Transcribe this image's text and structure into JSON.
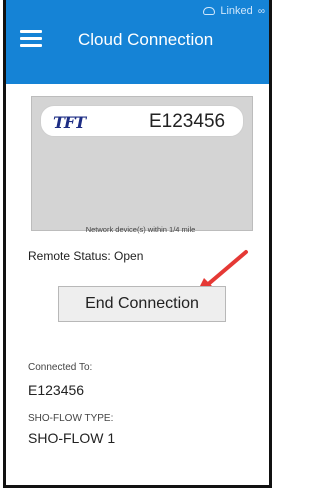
{
  "status_bar": {
    "linked_text": "Linked",
    "link_icon": "link-icon",
    "cloud_icon": "cloud-icon"
  },
  "app_bar": {
    "title": "Cloud Connection",
    "menu_icon": "hamburger-menu-icon"
  },
  "device": {
    "logo_text": "TFT",
    "id": "E123456"
  },
  "network_note": "Network device(s) within 1/4 mile",
  "remote_status": "Remote Status: Open",
  "end_connection_label": "End Connection",
  "connected_to": {
    "label": "Connected To:",
    "value": "E123456"
  },
  "sho_flow_type": {
    "label": "SHO-FLOW TYPE:",
    "value": "SHO-FLOW 1"
  },
  "colors": {
    "primary": "#1583d6",
    "arrow": "#e53935",
    "panel": "#d4d4d4"
  }
}
